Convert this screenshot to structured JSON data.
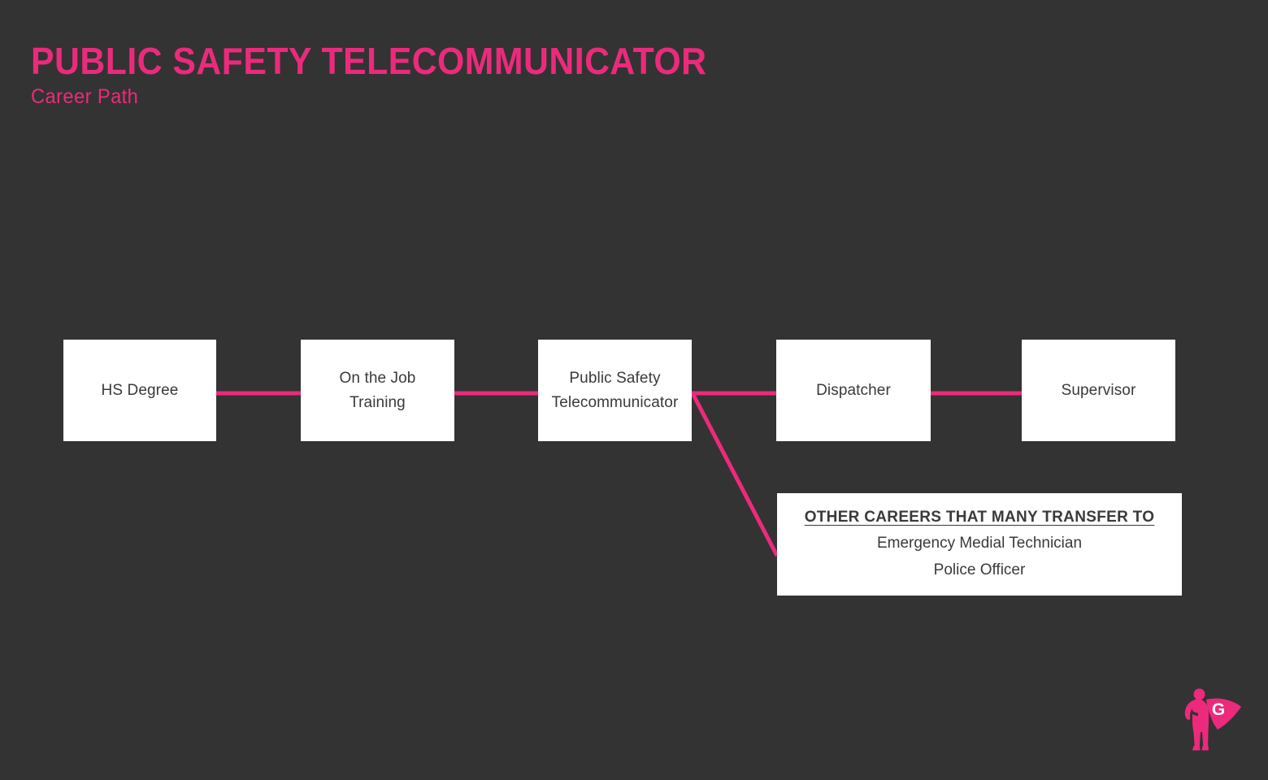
{
  "header": {
    "title": "PUBLIC SAFETY TELECOMMUNICATOR",
    "subtitle": "Career Path"
  },
  "colors": {
    "background": "#333333",
    "accent_pink": "#EC2A7B",
    "node_fill": "#FFFFFF",
    "node_text": "#3A3A3A"
  },
  "flow": {
    "nodes": [
      {
        "id": "hs-degree",
        "label": "HS Degree"
      },
      {
        "id": "ojt",
        "label": "On the Job\nTraining"
      },
      {
        "id": "pst",
        "label": "Public Safety\nTelecommunicator"
      },
      {
        "id": "dispatcher",
        "label": "Dispatcher"
      },
      {
        "id": "supervisor",
        "label": "Supervisor"
      }
    ],
    "other_careers": {
      "heading": "OTHER CAREERS THAT MANY TRANSFER TO",
      "items": [
        "Emergency Medial Technician",
        "Police Officer"
      ]
    },
    "connectors": [
      {
        "id": "hs-to-ojt",
        "from": "hs-degree",
        "to": "ojt",
        "type": "horizontal"
      },
      {
        "id": "ojt-to-pst",
        "from": "ojt",
        "to": "pst",
        "type": "horizontal"
      },
      {
        "id": "pst-to-dispatcher",
        "from": "pst",
        "to": "dispatcher",
        "type": "horizontal"
      },
      {
        "id": "dispatcher-to-supervisor",
        "from": "dispatcher",
        "to": "supervisor",
        "type": "horizontal"
      },
      {
        "id": "pst-to-other-careers",
        "from": "pst",
        "to": "other-careers",
        "type": "diagonal"
      }
    ]
  },
  "logo": {
    "name": "superhero-g-logo",
    "letter": "G"
  }
}
